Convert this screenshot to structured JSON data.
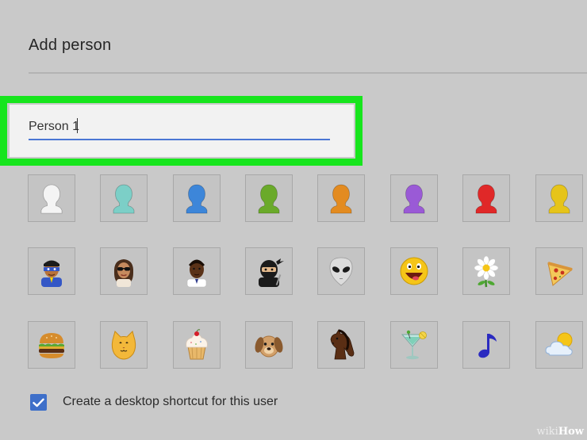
{
  "dialog": {
    "title": "Add person"
  },
  "name_field": {
    "value": "Person 1",
    "highlight_color": "#17e51d",
    "underline_color": "#4a76d4"
  },
  "avatars": [
    {
      "name": "avatar-generic-white",
      "icon": "silhouette-white-icon",
      "color": "#f4f4f4"
    },
    {
      "name": "avatar-generic-teal",
      "icon": "silhouette-teal-icon",
      "color": "#7ccfc7"
    },
    {
      "name": "avatar-generic-blue",
      "icon": "silhouette-blue-icon",
      "color": "#3d86d9"
    },
    {
      "name": "avatar-generic-green",
      "icon": "silhouette-green-icon",
      "color": "#6aaa2a"
    },
    {
      "name": "avatar-generic-orange",
      "icon": "silhouette-orange-icon",
      "color": "#e38b20"
    },
    {
      "name": "avatar-generic-purple",
      "icon": "silhouette-purple-icon",
      "color": "#9a5ad6"
    },
    {
      "name": "avatar-generic-red",
      "icon": "silhouette-red-icon",
      "color": "#e02828"
    },
    {
      "name": "avatar-generic-yellow",
      "icon": "silhouette-yellow-icon",
      "color": "#e6c41a"
    },
    {
      "name": "avatar-superhero",
      "icon": "superhero-icon"
    },
    {
      "name": "avatar-woman-sunglasses",
      "icon": "woman-sunglasses-icon"
    },
    {
      "name": "avatar-man",
      "icon": "man-icon"
    },
    {
      "name": "avatar-ninja",
      "icon": "ninja-icon"
    },
    {
      "name": "avatar-alien",
      "icon": "alien-icon"
    },
    {
      "name": "avatar-smiley",
      "icon": "smiley-icon"
    },
    {
      "name": "avatar-flower",
      "icon": "flower-icon"
    },
    {
      "name": "avatar-pizza",
      "icon": "pizza-icon"
    },
    {
      "name": "avatar-burger",
      "icon": "burger-icon"
    },
    {
      "name": "avatar-cat",
      "icon": "cat-icon"
    },
    {
      "name": "avatar-cupcake",
      "icon": "cupcake-icon"
    },
    {
      "name": "avatar-dog",
      "icon": "dog-icon"
    },
    {
      "name": "avatar-horse",
      "icon": "horse-icon"
    },
    {
      "name": "avatar-cocktail",
      "icon": "cocktail-icon"
    },
    {
      "name": "avatar-music-note",
      "icon": "music-note-icon"
    },
    {
      "name": "avatar-weather",
      "icon": "sun-cloud-icon"
    }
  ],
  "shortcut": {
    "checked": true,
    "label": "Create a desktop shortcut for this user",
    "check_color": "#3e6fc9"
  },
  "watermark": {
    "wiki": "wiki",
    "how": "How"
  }
}
